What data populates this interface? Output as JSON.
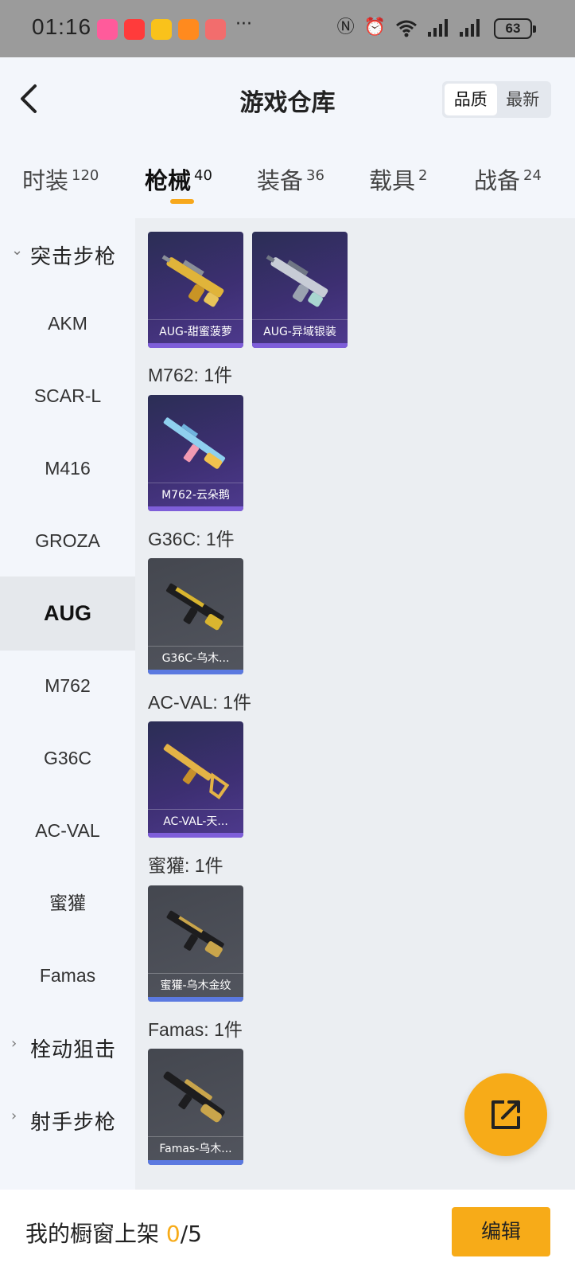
{
  "status_bar": {
    "time": "01:16",
    "more": "···",
    "battery": "63",
    "icons": [
      "nfc-icon",
      "alarm-icon",
      "wifi-icon",
      "signal-icon",
      "signal-icon",
      "battery-icon"
    ]
  },
  "header": {
    "title": "游戏仓库",
    "sort_options": [
      {
        "label": "品质",
        "active": true
      },
      {
        "label": "最新",
        "active": false
      }
    ]
  },
  "tabs": [
    {
      "label": "时装",
      "count": "120"
    },
    {
      "label": "枪械",
      "count": "40",
      "active": true
    },
    {
      "label": "装备",
      "count": "36"
    },
    {
      "label": "载具",
      "count": "2"
    },
    {
      "label": "战备",
      "count": "24"
    }
  ],
  "sidebar": {
    "groups": [
      {
        "label": "突击步枪",
        "expanded": true
      },
      {
        "label": "栓动狙击",
        "expanded": false
      },
      {
        "label": "射手步枪",
        "expanded": false
      }
    ],
    "items": [
      "AKM",
      "SCAR-L",
      "M416",
      "GROZA",
      "AUG",
      "M762",
      "G36C",
      "AC-VAL",
      "蜜獾",
      "Famas"
    ],
    "active_item": "AUG"
  },
  "main": {
    "sections": [
      {
        "label": "M762: 1件"
      },
      {
        "label": "G36C: 1件"
      },
      {
        "label": "AC-VAL: 1件"
      },
      {
        "label": "蜜獾: 1件"
      },
      {
        "label": "Famas: 1件"
      }
    ],
    "cards": [
      {
        "name": "AUG-甜蜜菠萝",
        "rarity": "purple"
      },
      {
        "name": "AUG-异域银装",
        "rarity": "purple"
      },
      {
        "name": "M762-云朵鹅",
        "rarity": "purple"
      },
      {
        "name": "G36C-乌木...",
        "rarity": "gray"
      },
      {
        "name": "AC-VAL-天...",
        "rarity": "purple"
      },
      {
        "name": "蜜獾-乌木金纹",
        "rarity": "gray"
      },
      {
        "name": "Famas-乌木...",
        "rarity": "gray"
      }
    ]
  },
  "bottom_bar": {
    "label": "我的橱窗上架",
    "current": "0",
    "total": "/5",
    "edit_label": "编辑"
  },
  "colors": {
    "accent": "#f7ab18",
    "rare_purple": "#3d2f72",
    "common_gray": "#52555e"
  }
}
